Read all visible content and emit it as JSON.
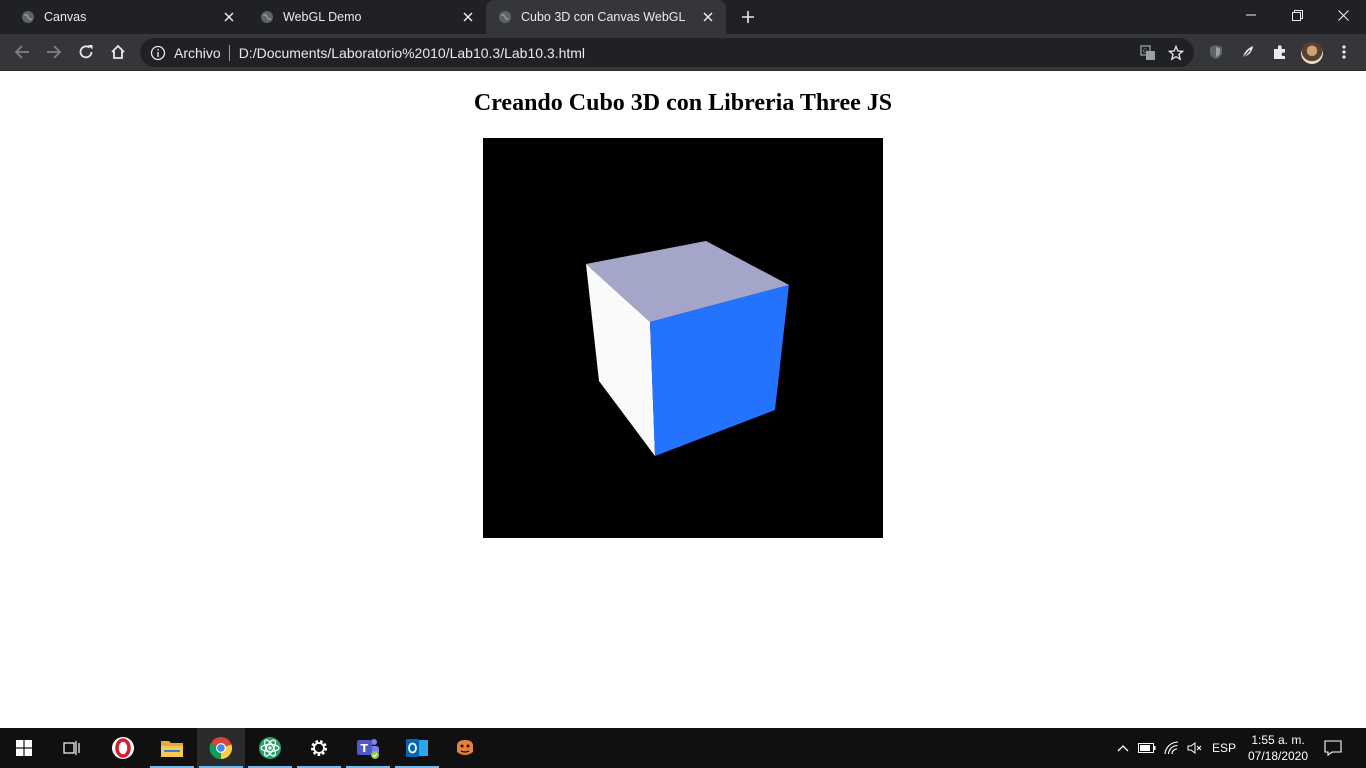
{
  "browser": {
    "tabs": [
      {
        "title": "Canvas",
        "active": false
      },
      {
        "title": "WebGL Demo",
        "active": false
      },
      {
        "title": "Cubo 3D con Canvas WebGL",
        "active": true
      }
    ],
    "omnibox": {
      "scheme_label": "Archivo",
      "url": "D:/Documents/Laboratorio%2010/Lab10.3/Lab10.3.html"
    },
    "icons": {
      "back": "arrow-left-icon",
      "forward": "arrow-right-icon",
      "reload": "reload-icon",
      "home": "home-icon",
      "site_info": "info-icon",
      "translate": "translate-icon",
      "bookmark": "star-icon",
      "extension_shield": "shield-icon",
      "extension_feather": "feather-icon",
      "extensions": "puzzle-icon",
      "menu": "kebab-menu-icon"
    }
  },
  "page": {
    "heading": "Creando Cubo 3D con Libreria Three JS",
    "canvas_background": "#000000",
    "cube_colors": {
      "top": "#a3a6c9",
      "left": "#fafafa",
      "front": "#2473ff"
    }
  },
  "taskbar": {
    "apps": [
      "windows-start-icon",
      "task-view-icon",
      "opera-icon",
      "file-explorer-icon",
      "chrome-icon",
      "atom-icon",
      "settings-icon",
      "teams-icon",
      "outlook-icon",
      "game-icon"
    ],
    "tray": {
      "language": "ESP",
      "time": "1:55 a. m.",
      "date": "07/18/2020"
    },
    "accent": "#76b9ed"
  }
}
